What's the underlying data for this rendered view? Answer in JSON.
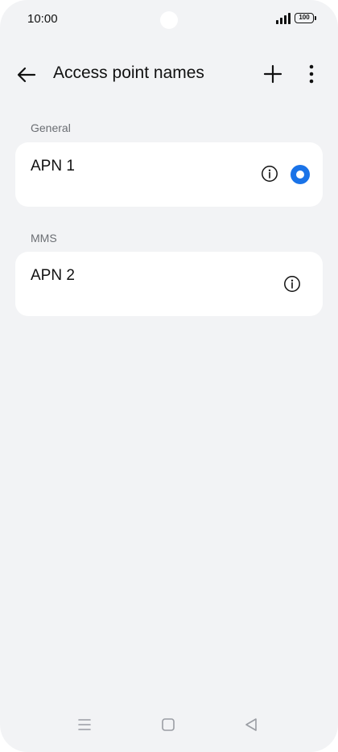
{
  "status_bar": {
    "time": "10:00",
    "battery": "100",
    "icons": [
      "signal-icon",
      "battery-icon",
      "camera-cutout"
    ]
  },
  "app_bar": {
    "title": "Access point names",
    "icons": [
      "back-arrow-icon",
      "plus-icon",
      "more-vert-icon"
    ]
  },
  "sections": [
    {
      "label": "General",
      "items": [
        {
          "name": "APN 1",
          "selected": true
        }
      ]
    },
    {
      "label": "MMS",
      "items": [
        {
          "name": "APN 2",
          "selected": false
        }
      ]
    }
  ],
  "nav_bar": {
    "icons": [
      "menu-icon",
      "home-icon",
      "back-triangle-icon"
    ]
  },
  "colors": {
    "background": "#f2f3f5",
    "card": "#ffffff",
    "accent": "#1a73e8",
    "text": "#111111",
    "secondary_text": "#6b6e73"
  }
}
